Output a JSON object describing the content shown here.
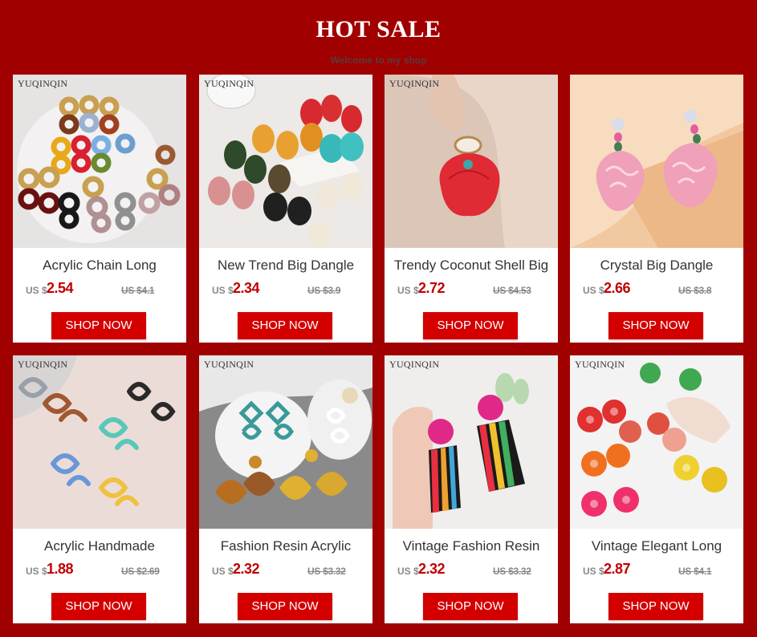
{
  "header": {
    "title": "HOT SALE",
    "subtitle": "Welcome to my shop"
  },
  "colors": {
    "background": "#a00000",
    "price": "#c00000",
    "button": "#d40000"
  },
  "products": [
    {
      "brand": "YUQINQIN",
      "name": "Acrylic Chain Long",
      "currency": "US $",
      "price": "2.54",
      "old_price": "US $4.1",
      "button": "SHOP NOW"
    },
    {
      "brand": "YUQINQIN",
      "name": "New Trend Big Dangle",
      "currency": "US $",
      "price": "2.34",
      "old_price": "US $3.9",
      "button": "SHOP NOW"
    },
    {
      "brand": "YUQINQIN",
      "name": "Trendy Coconut Shell Big",
      "currency": "US $",
      "price": "2.72",
      "old_price": "US $4.53",
      "button": "SHOP NOW"
    },
    {
      "brand": "",
      "name": "Crystal Big Dangle",
      "currency": "US $",
      "price": "2.66",
      "old_price": "US $3.8",
      "button": "SHOP NOW"
    },
    {
      "brand": "YUQINQIN",
      "name": "Acrylic Handmade",
      "currency": "US $",
      "price": "1.88",
      "old_price": "US $2.69",
      "button": "SHOP NOW"
    },
    {
      "brand": "YUQINQIN",
      "name": "Fashion Resin Acrylic",
      "currency": "US $",
      "price": "2.32",
      "old_price": "US $3.32",
      "button": "SHOP NOW"
    },
    {
      "brand": "YUQINQIN",
      "name": "Vintage Fashion Resin",
      "currency": "US $",
      "price": "2.32",
      "old_price": "US $3.32",
      "button": "SHOP NOW"
    },
    {
      "brand": "YUQINQIN",
      "name": "Vintage Elegant Long",
      "currency": "US $",
      "price": "2.87",
      "old_price": "US $4.1",
      "button": "SHOP NOW"
    }
  ]
}
